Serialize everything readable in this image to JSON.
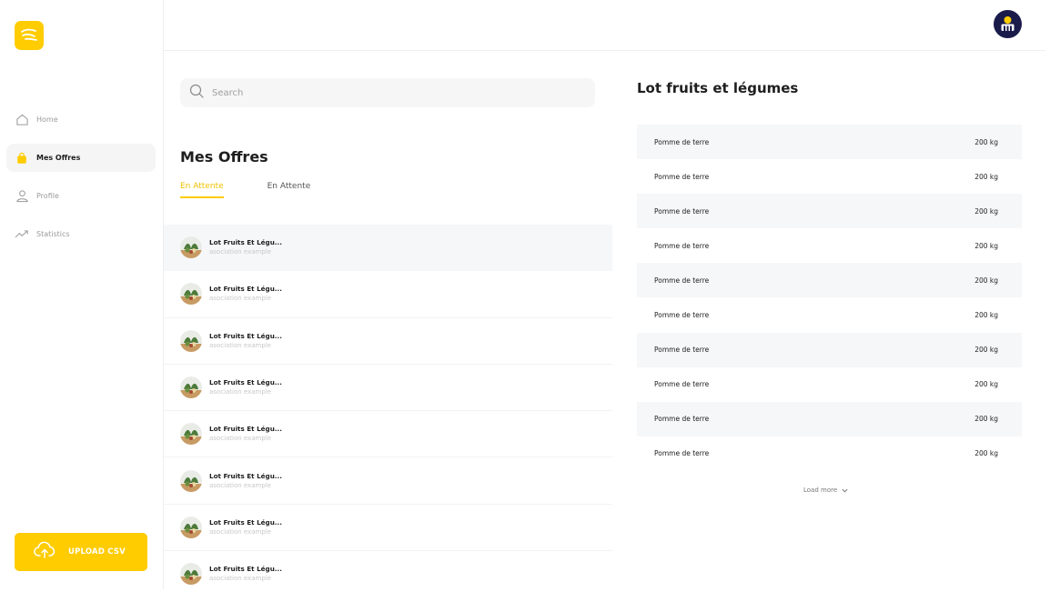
{
  "sidebar": {
    "items": [
      {
        "label": "Home",
        "icon": "home-icon"
      },
      {
        "label": "Mes Offres",
        "icon": "bag-icon"
      },
      {
        "label": "Profile",
        "icon": "user-icon"
      },
      {
        "label": "Statistics",
        "icon": "trend-icon"
      }
    ],
    "upload_label": "UPLOAD CSV"
  },
  "search": {
    "placeholder": "Search"
  },
  "main": {
    "title": "Mes Offres",
    "tabs": [
      {
        "label": "En Attente"
      },
      {
        "label": "En Attente"
      }
    ],
    "offers": [
      {
        "title": "Lot Fruits Et Légu...",
        "subtitle": "asociation example"
      },
      {
        "title": "Lot Fruits Et Légu...",
        "subtitle": "asociation example"
      },
      {
        "title": "Lot Fruits Et Légu...",
        "subtitle": "asociation example"
      },
      {
        "title": "Lot Fruits Et Légu...",
        "subtitle": "asociation example"
      },
      {
        "title": "Lot Fruits Et Légu...",
        "subtitle": "asociation example"
      },
      {
        "title": "Lot Fruits Et Légu...",
        "subtitle": "asociation example"
      },
      {
        "title": "Lot Fruits Et Légu...",
        "subtitle": "asociation example"
      },
      {
        "title": "Lot Fruits Et Légu...",
        "subtitle": "asociation example"
      }
    ]
  },
  "detail": {
    "title": "Lot fruits et légumes",
    "rows": [
      {
        "name": "Pomme de terre",
        "qty": "200 kg"
      },
      {
        "name": "Pomme de terre",
        "qty": "200 kg"
      },
      {
        "name": "Pomme de terre",
        "qty": "200 kg"
      },
      {
        "name": "Pomme de terre",
        "qty": "200 kg"
      },
      {
        "name": "Pomme de terre",
        "qty": "200 kg"
      },
      {
        "name": "Pomme de terre",
        "qty": "200 kg"
      },
      {
        "name": "Pomme de terre",
        "qty": "200 kg"
      },
      {
        "name": "Pomme de terre",
        "qty": "200 kg"
      },
      {
        "name": "Pomme de terre",
        "qty": "200 kg"
      },
      {
        "name": "Pomme de terre",
        "qty": "200 kg"
      }
    ],
    "load_more": "Load more"
  },
  "colors": {
    "accent": "#ffcc00",
    "avatar_bg": "#1b1b4b",
    "row_shade": "#f6f7f8"
  }
}
